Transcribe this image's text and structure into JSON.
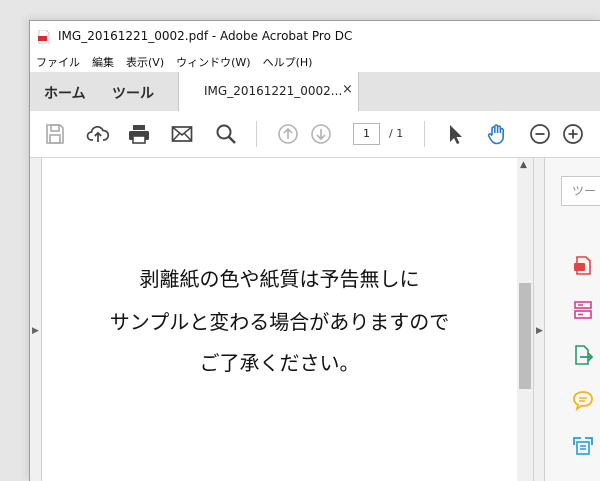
{
  "window": {
    "title": "IMG_20161221_0002.pdf - Adobe Acrobat Pro DC"
  },
  "menu": [
    "ファイル",
    "編集",
    "表示(V)",
    "ウィンドウ(W)",
    "ヘルプ(H)"
  ],
  "tabs": {
    "home": "ホーム",
    "tools": "ツール",
    "document": "IMG_20161221_0002...",
    "close": "×"
  },
  "toolbar": {
    "current_page": "1",
    "page_total": "/ 1"
  },
  "document": {
    "lines": [
      "剥離紙の色や紙質は予告無しに",
      "サンプルと変わる場合がありますので",
      "ご了承ください。"
    ]
  },
  "right_panel": {
    "search_placeholder": "ツー"
  },
  "colors": {
    "accent_blue": "#2b7bc9",
    "export_red": "#e0454a",
    "organize_pink": "#d6408f",
    "export_green": "#2b9a6a",
    "comment_yellow": "#f2b51f",
    "scan_teal": "#2a9bd6"
  }
}
